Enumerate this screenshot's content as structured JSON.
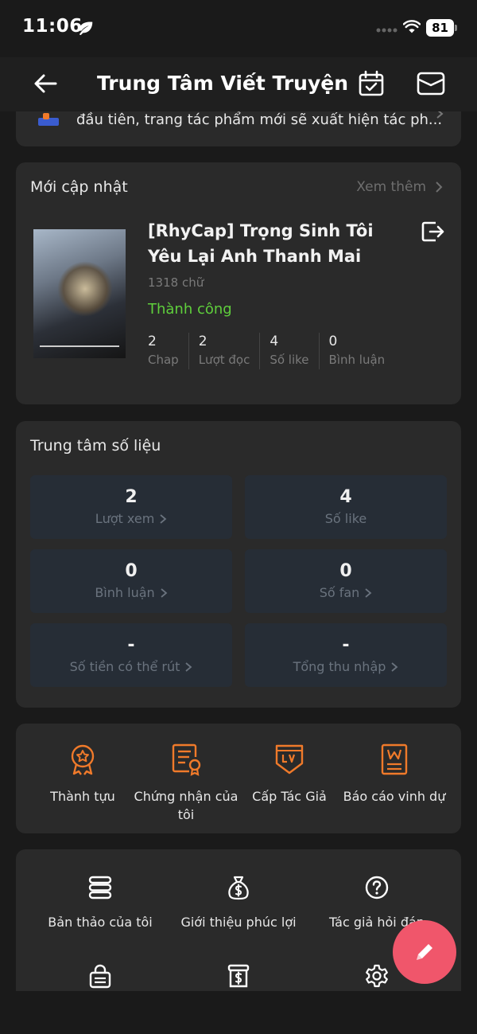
{
  "status_bar": {
    "time": "11:06",
    "battery": "81"
  },
  "nav": {
    "title": "Trung Tâm Viết Truyện"
  },
  "notice": {
    "text": "đầu tiên, trang tác phẩm mới sẽ xuất hiện tác ph..."
  },
  "updates": {
    "title": "Mới cập nhật",
    "see_more": "Xem thêm",
    "story": {
      "title": "[RhyCap] Trọng Sinh Tôi Yêu Lại Anh Thanh Mai",
      "word_count": "1318 chữ",
      "status": "Thành công",
      "stats": [
        {
          "value": "2",
          "label": "Chap"
        },
        {
          "value": "2",
          "label": "Lượt đọc"
        },
        {
          "value": "4",
          "label": "Số like"
        },
        {
          "value": "0",
          "label": "Bình luận"
        }
      ]
    }
  },
  "data_center": {
    "title": "Trung tâm số liệu",
    "tiles": [
      {
        "value": "2",
        "label": "Lượt xem",
        "has_arrow": true
      },
      {
        "value": "4",
        "label": "Số like",
        "has_arrow": false
      },
      {
        "value": "0",
        "label": "Bình luận",
        "has_arrow": true
      },
      {
        "value": "0",
        "label": "Số fan",
        "has_arrow": true
      },
      {
        "value": "-",
        "label": "Số tiền có thể rút",
        "has_arrow": true
      },
      {
        "value": "-",
        "label": "Tổng thu nhập",
        "has_arrow": true
      }
    ]
  },
  "honors": [
    {
      "label": "Thành tựu",
      "icon": "medal-icon"
    },
    {
      "label": "Chứng nhận của tôi",
      "icon": "certificate-icon"
    },
    {
      "label": "Cấp Tác Giả",
      "icon": "author-level-icon"
    },
    {
      "label": "Báo cáo vinh dự",
      "icon": "honor-report-icon"
    }
  ],
  "tools": [
    {
      "label": "Bản thảo của tôi",
      "icon": "drafts-icon"
    },
    {
      "label": "Giới thiệu phúc lợi",
      "icon": "money-bag-icon"
    },
    {
      "label": "Tác giả hỏi đáp",
      "icon": "help-icon"
    }
  ],
  "colors": {
    "accent": "#f07a2a",
    "success": "#5fcf3c",
    "fab": "#f0566b",
    "card": "#2a2a2a",
    "tile": "#262d36"
  }
}
